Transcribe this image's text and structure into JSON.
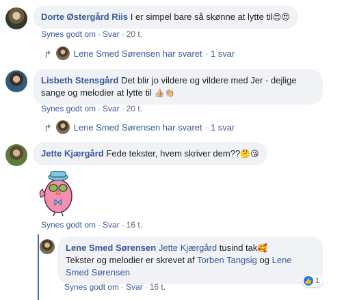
{
  "comments": [
    {
      "author": "Dorte Østergård Riis",
      "text": "I er simpel bare så skønne at lytte til",
      "emoji": "😍😍",
      "like_label": "Synes godt om",
      "reply_label": "Svar",
      "time": "20 t.",
      "replies_summary": {
        "text": "Lene Smed Sørensen har svaret",
        "count": "1 svar"
      }
    },
    {
      "author": "Lisbeth Stensgård",
      "text_line1": "Det blir jo vildere og vildere med Jer - dejlige",
      "text_line2": "sange og melodier at lytte til",
      "emoji": "👍🏼👏🏼",
      "like_label": "Synes godt om",
      "reply_label": "Svar",
      "time": "20 t.",
      "replies_summary": {
        "text": "Lene Smed Sørensen har svaret",
        "count": "1 svar"
      }
    },
    {
      "author": "Jette Kjærgård",
      "text": "Fede tekster, hvem skriver dem??",
      "emoji": "🤔😘",
      "like_label": "Synes godt om",
      "reply_label": "Svar",
      "time": "16 t."
    }
  ],
  "reply": {
    "author": "Lene Smed Sørensen",
    "mention": "Jette Kjærgård",
    "text1": "tusind tak",
    "emoji": "🥰",
    "text2": "Tekster og melodier er skrevet af",
    "mention2": "Torben Tangsig",
    "text3": "og",
    "mention3_line1": "Lene",
    "mention3_line2": "Smed Sørensen",
    "like_label": "Synes godt om",
    "reply_label": "Svar",
    "time": "16 t.",
    "reaction_count": "1"
  },
  "colors": {
    "link": "#385898",
    "bubble": "#f0f2f5",
    "thread_line": "#4267b2",
    "muted": "#606770"
  }
}
